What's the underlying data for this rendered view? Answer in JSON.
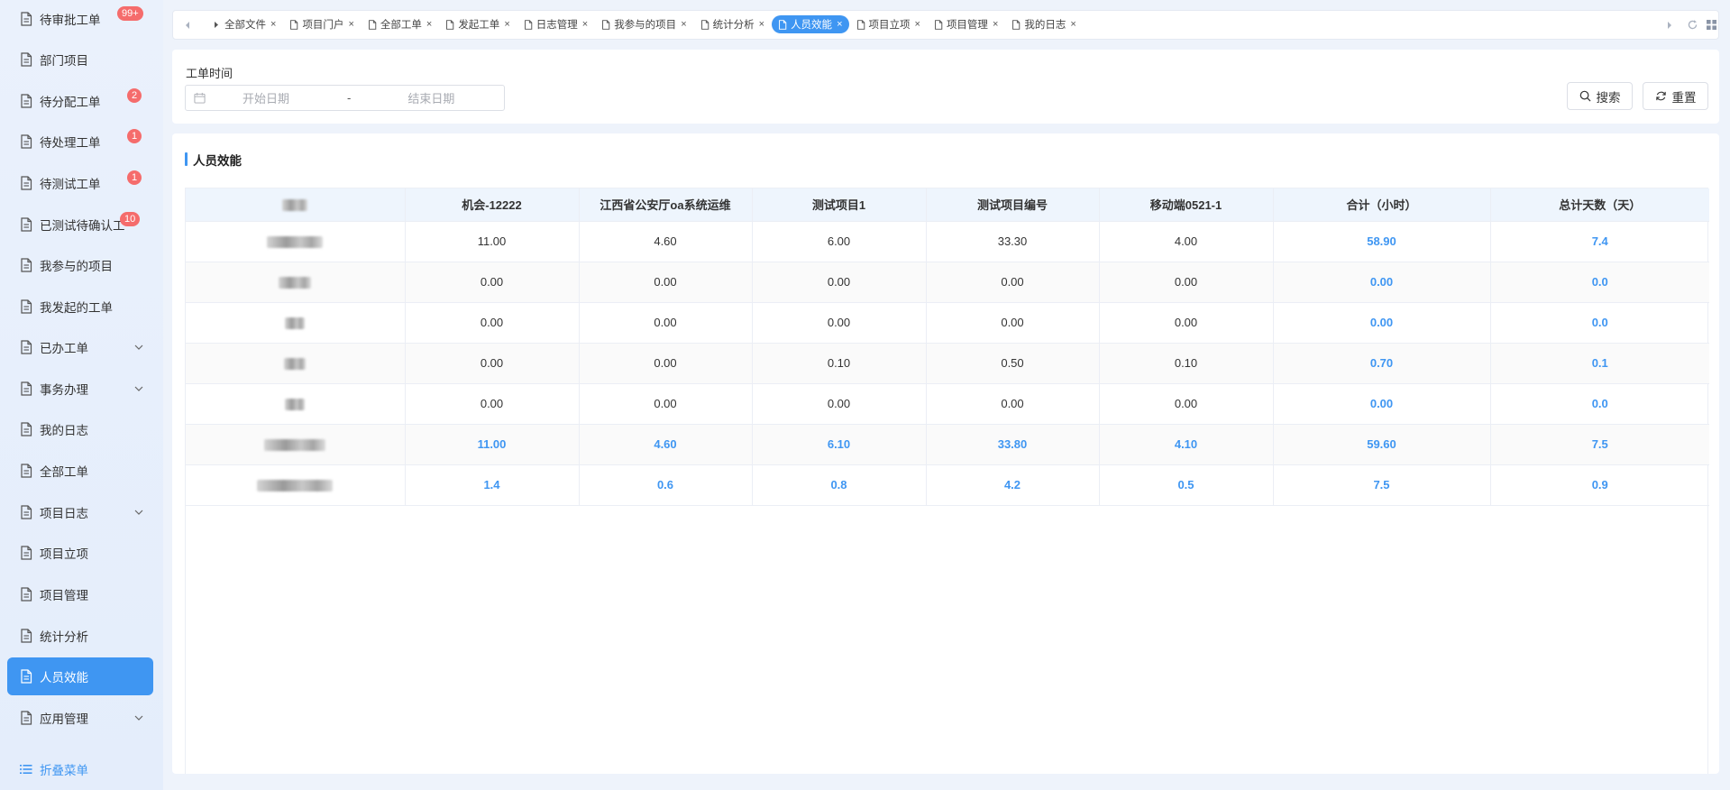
{
  "sidebar": {
    "items": [
      {
        "label": "待审批工单",
        "badge": "99+"
      },
      {
        "label": "部门项目",
        "badge": ""
      },
      {
        "label": "待分配工单",
        "badge": "2"
      },
      {
        "label": "待处理工单",
        "badge": "1"
      },
      {
        "label": "待测试工单",
        "badge": "1"
      },
      {
        "label": "已测试待确认工单",
        "badge": "10"
      },
      {
        "label": "我参与的项目",
        "badge": ""
      },
      {
        "label": "我发起的工单",
        "badge": ""
      },
      {
        "label": "已办工单",
        "badge": "",
        "expandable": true
      },
      {
        "label": "事务办理",
        "badge": "",
        "expandable": true
      },
      {
        "label": "我的日志",
        "badge": ""
      },
      {
        "label": "全部工单",
        "badge": ""
      },
      {
        "label": "项目日志",
        "badge": "",
        "expandable": true
      },
      {
        "label": "项目立项",
        "badge": ""
      },
      {
        "label": "项目管理",
        "badge": ""
      },
      {
        "label": "统计分析",
        "badge": ""
      },
      {
        "label": "人员效能",
        "badge": "",
        "active": true
      },
      {
        "label": "应用管理",
        "badge": "",
        "expandable": true
      }
    ],
    "collapse_label": "折叠菜单"
  },
  "tabs": [
    {
      "label": "全部文件",
      "active": false,
      "icon": "caret-right-icon"
    },
    {
      "label": "项目门户",
      "active": false,
      "icon": "document-icon"
    },
    {
      "label": "全部工单",
      "active": false,
      "icon": "document-icon"
    },
    {
      "label": "发起工单",
      "active": false,
      "icon": "document-icon"
    },
    {
      "label": "日志管理",
      "active": false,
      "icon": "document-icon"
    },
    {
      "label": "我参与的项目",
      "active": false,
      "icon": "document-icon"
    },
    {
      "label": "统计分析",
      "active": false,
      "icon": "document-icon"
    },
    {
      "label": "人员效能",
      "active": true,
      "icon": "document-icon"
    },
    {
      "label": "项目立项",
      "active": false,
      "icon": "document-icon"
    },
    {
      "label": "项目管理",
      "active": false,
      "icon": "document-icon"
    },
    {
      "label": "我的日志",
      "active": false,
      "icon": "document-icon"
    }
  ],
  "tab_close_glyph": "×",
  "search": {
    "field_label": "工单时间",
    "start_placeholder": "开始日期",
    "separator": "-",
    "end_placeholder": "结束日期",
    "search_button": "搜索",
    "reset_button": "重置"
  },
  "main": {
    "title": "人员效能",
    "columns": [
      "",
      "机会-12222",
      "江西省公安厅oa系统运维",
      "测试项目1",
      "测试项目编号",
      "移动端0521-1",
      "合计（小时）",
      "总计天数（天）"
    ],
    "rows": [
      {
        "values": [
          "11.00",
          "4.60",
          "6.00",
          "33.30",
          "4.00",
          "58.90",
          "7.4"
        ],
        "emphasis": false
      },
      {
        "values": [
          "0.00",
          "0.00",
          "0.00",
          "0.00",
          "0.00",
          "0.00",
          "0.0"
        ],
        "emphasis": false
      },
      {
        "values": [
          "0.00",
          "0.00",
          "0.00",
          "0.00",
          "0.00",
          "0.00",
          "0.0"
        ],
        "emphasis": false
      },
      {
        "values": [
          "0.00",
          "0.00",
          "0.10",
          "0.50",
          "0.10",
          "0.70",
          "0.1"
        ],
        "emphasis": false
      },
      {
        "values": [
          "0.00",
          "0.00",
          "0.00",
          "0.00",
          "0.00",
          "0.00",
          "0.0"
        ],
        "emphasis": false
      },
      {
        "values": [
          "11.00",
          "4.60",
          "6.10",
          "33.80",
          "4.10",
          "59.60",
          "7.5"
        ],
        "emphasis": true
      },
      {
        "values": [
          "1.4",
          "0.6",
          "0.8",
          "4.2",
          "0.5",
          "7.5",
          "0.9"
        ],
        "emphasis": true
      }
    ],
    "name_placeholder_widths": [
      28,
      62,
      36,
      22,
      24,
      22,
      68,
      84
    ]
  },
  "colors": {
    "accent": "#3f96f2",
    "badge": "#f56c6c",
    "header_bg": "#eef5fd",
    "page_bg": "#eef3fb"
  }
}
